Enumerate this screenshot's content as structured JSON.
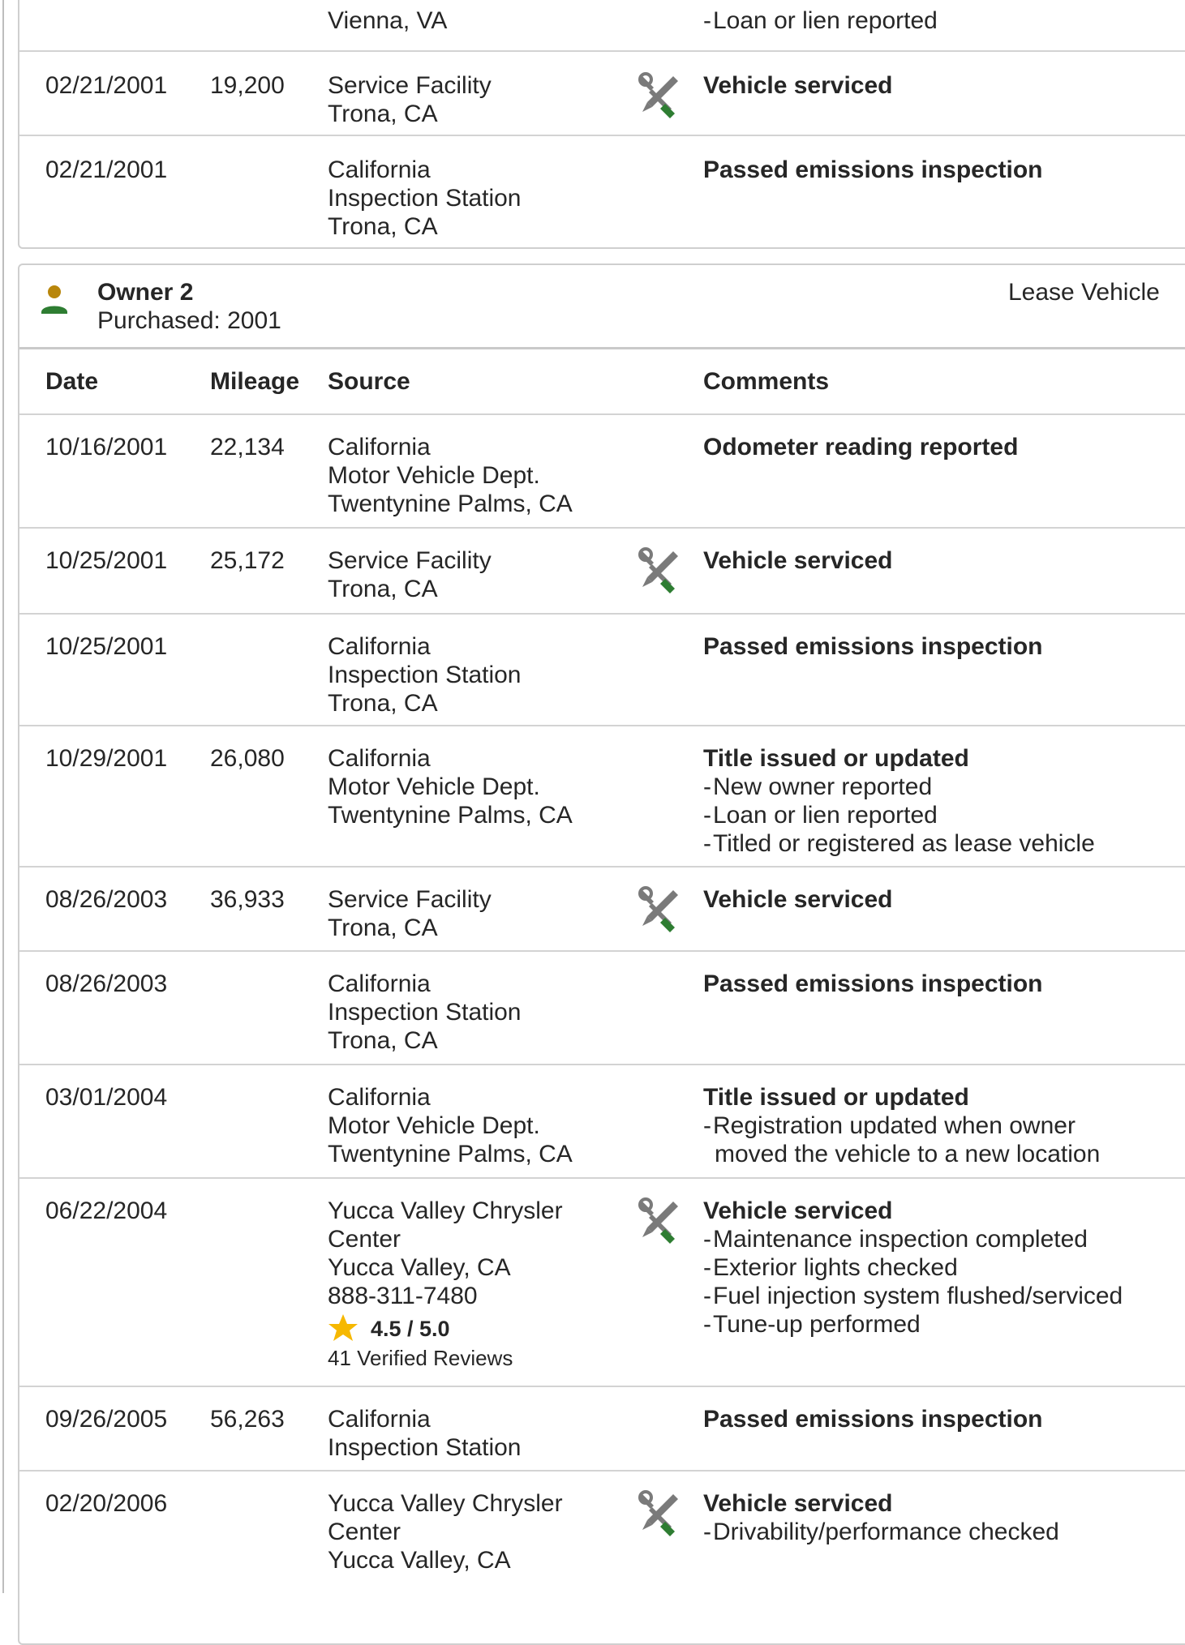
{
  "colors": {
    "accent_green": "#2e7d32",
    "icon_gray": "#7a7a7a",
    "owner_gold": "#b8860b",
    "star": "#f6b800"
  },
  "top_card": {
    "rows": [
      {
        "date": "",
        "mileage": "",
        "source": [
          "Vienna, VA"
        ],
        "title": "",
        "bullets": [
          "Loan or lien reported"
        ],
        "icon": ""
      },
      {
        "date": "02/21/2001",
        "mileage": "19,200",
        "source": [
          "Service Facility",
          "Trona, CA"
        ],
        "title": "Vehicle serviced",
        "bullets": [],
        "icon": "wrench-screwdriver-icon"
      },
      {
        "date": "02/21/2001",
        "mileage": "",
        "source": [
          "California",
          "Inspection Station",
          "Trona, CA"
        ],
        "title": "Passed emissions inspection",
        "bullets": [],
        "icon": ""
      }
    ]
  },
  "owner": {
    "icon": "person-icon",
    "title": "Owner 2",
    "purchased": "Purchased: 2001",
    "type": "Lease Vehicle",
    "headers": {
      "date": "Date",
      "mileage": "Mileage",
      "source": "Source",
      "comments": "Comments"
    },
    "rows": [
      {
        "date": "10/16/2001",
        "mileage": "22,134",
        "source": [
          "California",
          "Motor Vehicle Dept.",
          "Twentynine Palms, CA"
        ],
        "title": "Odometer reading reported",
        "bullets": []
      },
      {
        "date": "10/25/2001",
        "mileage": "25,172",
        "source": [
          "Service Facility",
          "Trona, CA"
        ],
        "title": "Vehicle serviced",
        "bullets": [],
        "icon": "wrench-screwdriver-icon"
      },
      {
        "date": "10/25/2001",
        "mileage": "",
        "source": [
          "California",
          "Inspection Station",
          "Trona, CA"
        ],
        "title": "Passed emissions inspection",
        "bullets": []
      },
      {
        "date": "10/29/2001",
        "mileage": "26,080",
        "source": [
          "California",
          "Motor Vehicle Dept.",
          "Twentynine Palms, CA"
        ],
        "title": "Title issued or updated",
        "bullets": [
          "New owner reported",
          "Loan or lien reported",
          "Titled or registered as lease vehicle"
        ]
      },
      {
        "date": "08/26/2003",
        "mileage": "36,933",
        "source": [
          "Service Facility",
          "Trona, CA"
        ],
        "title": "Vehicle serviced",
        "bullets": [],
        "icon": "wrench-screwdriver-icon"
      },
      {
        "date": "08/26/2003",
        "mileage": "",
        "source": [
          "California",
          "Inspection Station",
          "Trona, CA"
        ],
        "title": "Passed emissions inspection",
        "bullets": []
      },
      {
        "date": "03/01/2004",
        "mileage": "",
        "source": [
          "California",
          "Motor Vehicle Dept.",
          "Twentynine Palms, CA"
        ],
        "title": "Title issued or updated",
        "bullets": [
          "Registration updated when owner",
          "moved the vehicle to a new location"
        ]
      },
      {
        "date": "06/22/2004",
        "mileage": "",
        "source": [
          "Yucca Valley Chrysler",
          "Center",
          "Yucca Valley, CA",
          "888-311-7480"
        ],
        "rating": "4.5 / 5.0",
        "reviews": "41 Verified Reviews",
        "title": "Vehicle serviced",
        "bullets": [
          "Maintenance inspection completed",
          "Exterior lights checked",
          "Fuel injection system flushed/serviced",
          "Tune-up performed"
        ],
        "icon": "wrench-screwdriver-icon"
      },
      {
        "date": "09/26/2005",
        "mileage": "56,263",
        "source": [
          "California",
          "Inspection Station"
        ],
        "title": "Passed emissions inspection",
        "bullets": []
      },
      {
        "date": "02/20/2006",
        "mileage": "",
        "source": [
          "Yucca Valley Chrysler",
          "Center",
          "Yucca Valley, CA"
        ],
        "title": "Vehicle serviced",
        "bullets": [
          "Drivability/performance checked"
        ],
        "icon": "wrench-screwdriver-icon"
      }
    ]
  }
}
